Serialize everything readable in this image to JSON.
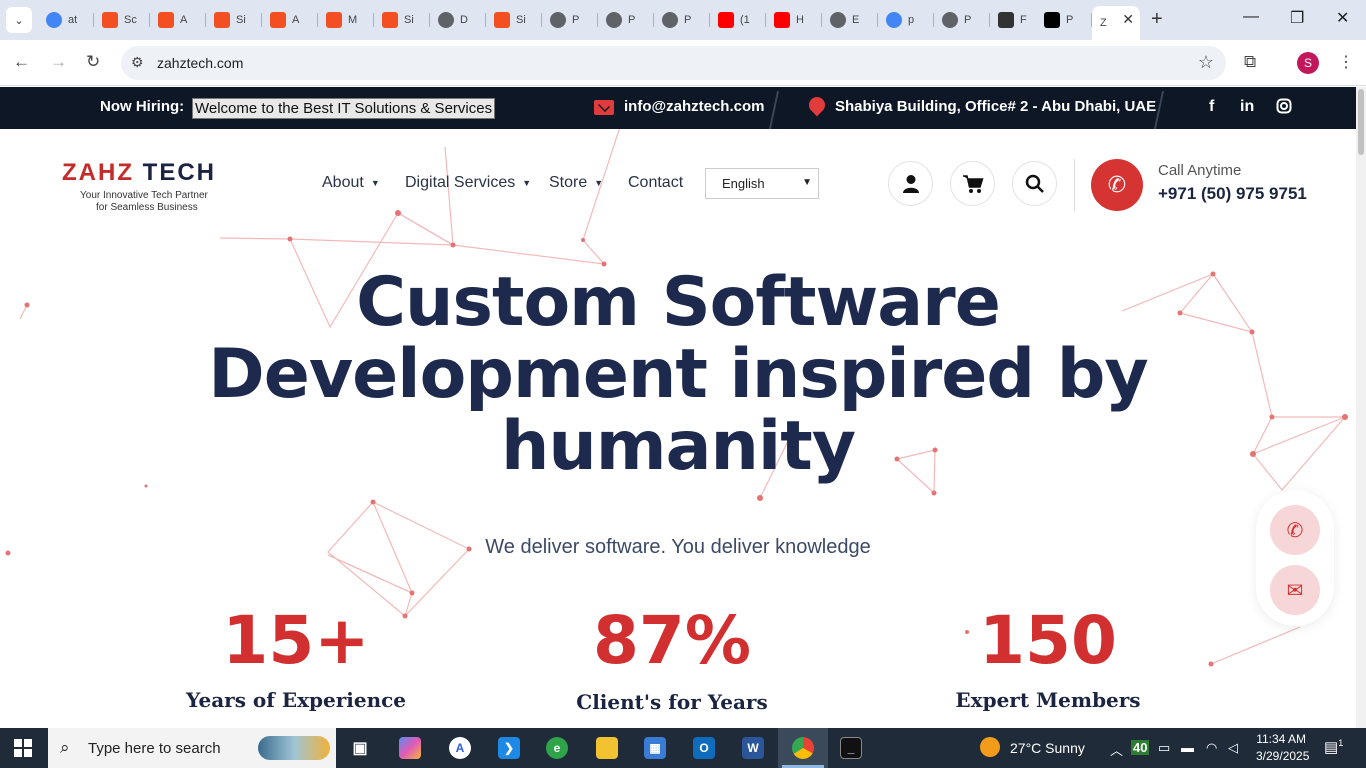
{
  "browser": {
    "tabs": [
      {
        "label": "at",
        "icon": "google-icon",
        "color": "#4285f4"
      },
      {
        "label": "Sc",
        "icon": "microsoft-icon",
        "color": "#f25022"
      },
      {
        "label": "A",
        "icon": "microsoft-icon",
        "color": "#f25022"
      },
      {
        "label": "Si",
        "icon": "microsoft-icon",
        "color": "#f25022"
      },
      {
        "label": "A",
        "icon": "microsoft-icon",
        "color": "#f25022"
      },
      {
        "label": "M",
        "icon": "microsoft-icon",
        "color": "#f25022"
      },
      {
        "label": "Si",
        "icon": "microsoft-icon",
        "color": "#f25022"
      },
      {
        "label": "D",
        "icon": "globe-icon",
        "color": "#5f6368"
      },
      {
        "label": "Si",
        "icon": "microsoft-icon",
        "color": "#f25022"
      },
      {
        "label": "P",
        "icon": "globe-icon",
        "color": "#5f6368"
      },
      {
        "label": "P",
        "icon": "globe-icon",
        "color": "#5f6368"
      },
      {
        "label": "P",
        "icon": "globe-icon",
        "color": "#5f6368"
      },
      {
        "label": "(1",
        "icon": "youtube-icon",
        "color": "#ff0000"
      },
      {
        "label": "H",
        "icon": "youtube-icon",
        "color": "#ff0000"
      },
      {
        "label": "E",
        "icon": "globe-icon",
        "color": "#5f6368"
      },
      {
        "label": "p",
        "icon": "google-icon",
        "color": "#4285f4"
      },
      {
        "label": "P",
        "icon": "globe-icon",
        "color": "#5f6368"
      },
      {
        "label": "F",
        "icon": "compass-icon",
        "color": "#333333"
      },
      {
        "label": "P",
        "icon": "triangle-icon",
        "color": "#000000"
      }
    ],
    "active_tab": {
      "label": "Z"
    },
    "url": "zahztech.com"
  },
  "site": {
    "topbar": {
      "hiring_label": "Now Hiring:",
      "hiring_text": "Welcome to the Best IT Solutions & Services",
      "email": "info@zahztech.com",
      "address": "Shabiya Building, Office# 2 - Abu Dhabi, UAE",
      "social": [
        "f",
        "in",
        "ig"
      ]
    },
    "logo": {
      "brand1": "ZAHZ",
      "brand2": "TECH",
      "tagline1": "Your Innovative Tech Partner",
      "tagline2": "for Seamless Business"
    },
    "nav": {
      "about": "About",
      "digital": "Digital Services",
      "store": "Store",
      "contact": "Contact",
      "language": "English"
    },
    "call": {
      "label": "Call Anytime",
      "number": "+971 (50) 975 9751"
    },
    "hero": {
      "title_line1": "Custom Software",
      "title_line2": "Development inspired by",
      "title_line3": "humanity",
      "subtitle": "We deliver software. You deliver knowledge"
    },
    "stats": [
      {
        "value": "15+",
        "label": "Years of Experience"
      },
      {
        "value": "87%",
        "label": "Client's for Years"
      },
      {
        "value": "150",
        "label": "Expert Members"
      }
    ],
    "accent_color": "#d23030",
    "navy_color": "#1d2a4d"
  },
  "taskbar": {
    "search_placeholder": "Type here to search",
    "weather": "27°C  Sunny",
    "battery": "40",
    "time": "11:34 AM",
    "date": "3/29/2025",
    "notification_badge": "1"
  }
}
